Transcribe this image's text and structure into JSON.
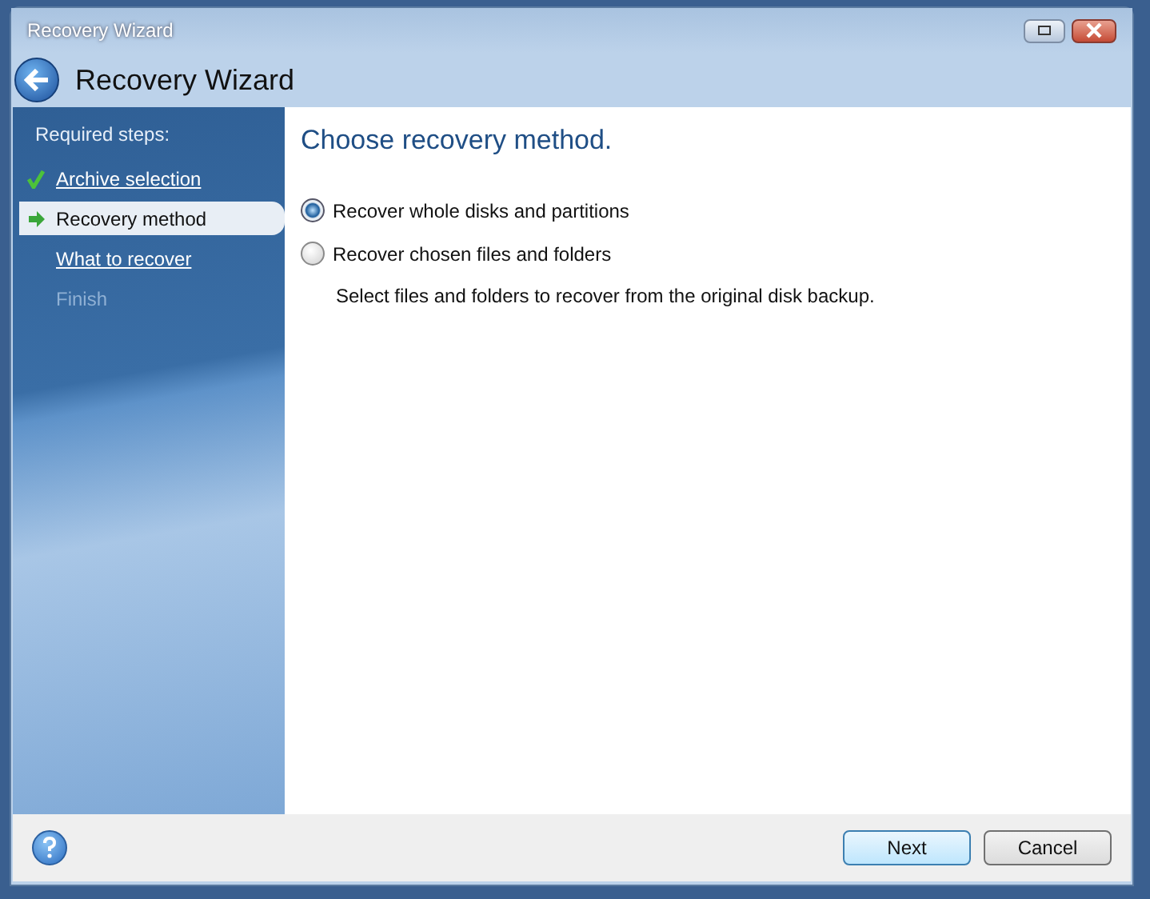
{
  "window": {
    "title": "Recovery Wizard"
  },
  "header": {
    "title": "Recovery Wizard"
  },
  "sidebar": {
    "heading": "Required steps:",
    "steps": [
      {
        "label": "Archive selection",
        "kind": "done",
        "selected": false
      },
      {
        "label": "Recovery method",
        "kind": "current",
        "selected": true
      },
      {
        "label": "What to recover",
        "kind": "pending",
        "selected": false
      },
      {
        "label": "Finish",
        "kind": "disabled",
        "selected": false
      }
    ]
  },
  "content": {
    "title": "Choose recovery method.",
    "options": [
      {
        "label": "Recover whole disks and partitions",
        "selected": true
      },
      {
        "label": "Recover chosen files and folders",
        "selected": false,
        "description": "Select files and folders to recover from the original disk backup."
      }
    ]
  },
  "buttons": [
    {
      "label": "Next",
      "kind": "default"
    },
    {
      "label": "Cancel",
      "kind": "normal"
    }
  ]
}
